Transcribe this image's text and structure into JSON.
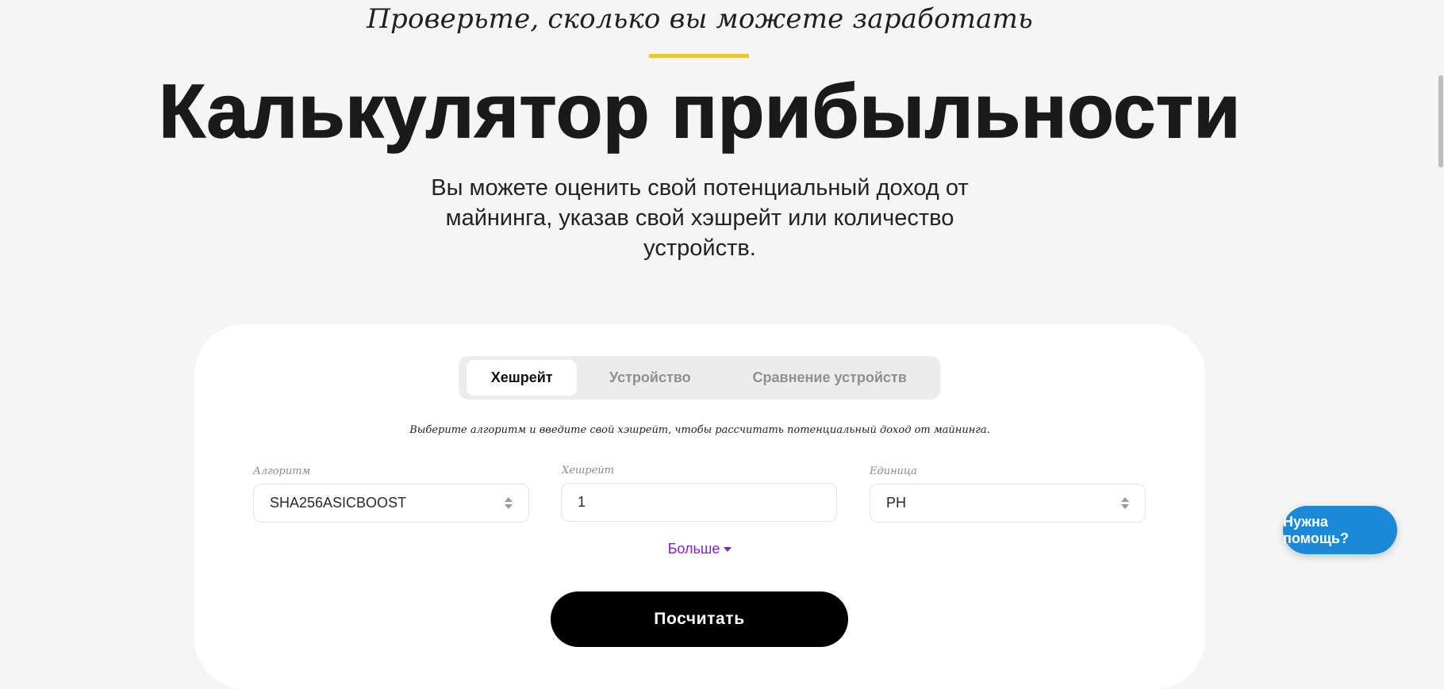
{
  "hero": {
    "eyebrow": "Проверьте, сколько вы можете заработать",
    "title": "Калькулятор прибыльности",
    "subtitle": "Вы можете оценить свой потенциальный доход от майнинга, указав свой хэшрейт или количество устройств."
  },
  "colors": {
    "accent_line": "#f2c33d",
    "more_link": "#8a1fc2",
    "help_button": "#1a8ad8",
    "primary_button": "#000000"
  },
  "calculator": {
    "tabs": [
      {
        "label": "Хешрейт",
        "active": true
      },
      {
        "label": "Устройство",
        "active": false
      },
      {
        "label": "Сравнение устройств",
        "active": false
      }
    ],
    "hint": "Выберите алгоритм и введите свой хэшрейт, чтобы рассчитать потенциальный доход от майнинга.",
    "fields": {
      "algorithm": {
        "label": "Алгоритм",
        "value": "SHA256ASICBOOST"
      },
      "hashrate": {
        "label": "Хешрейт",
        "value": "1"
      },
      "unit": {
        "label": "Единица",
        "value": "PH"
      }
    },
    "more_label": "Больше",
    "calculate_label": "Посчитать"
  },
  "help": {
    "label": "Нужна помощь?"
  }
}
